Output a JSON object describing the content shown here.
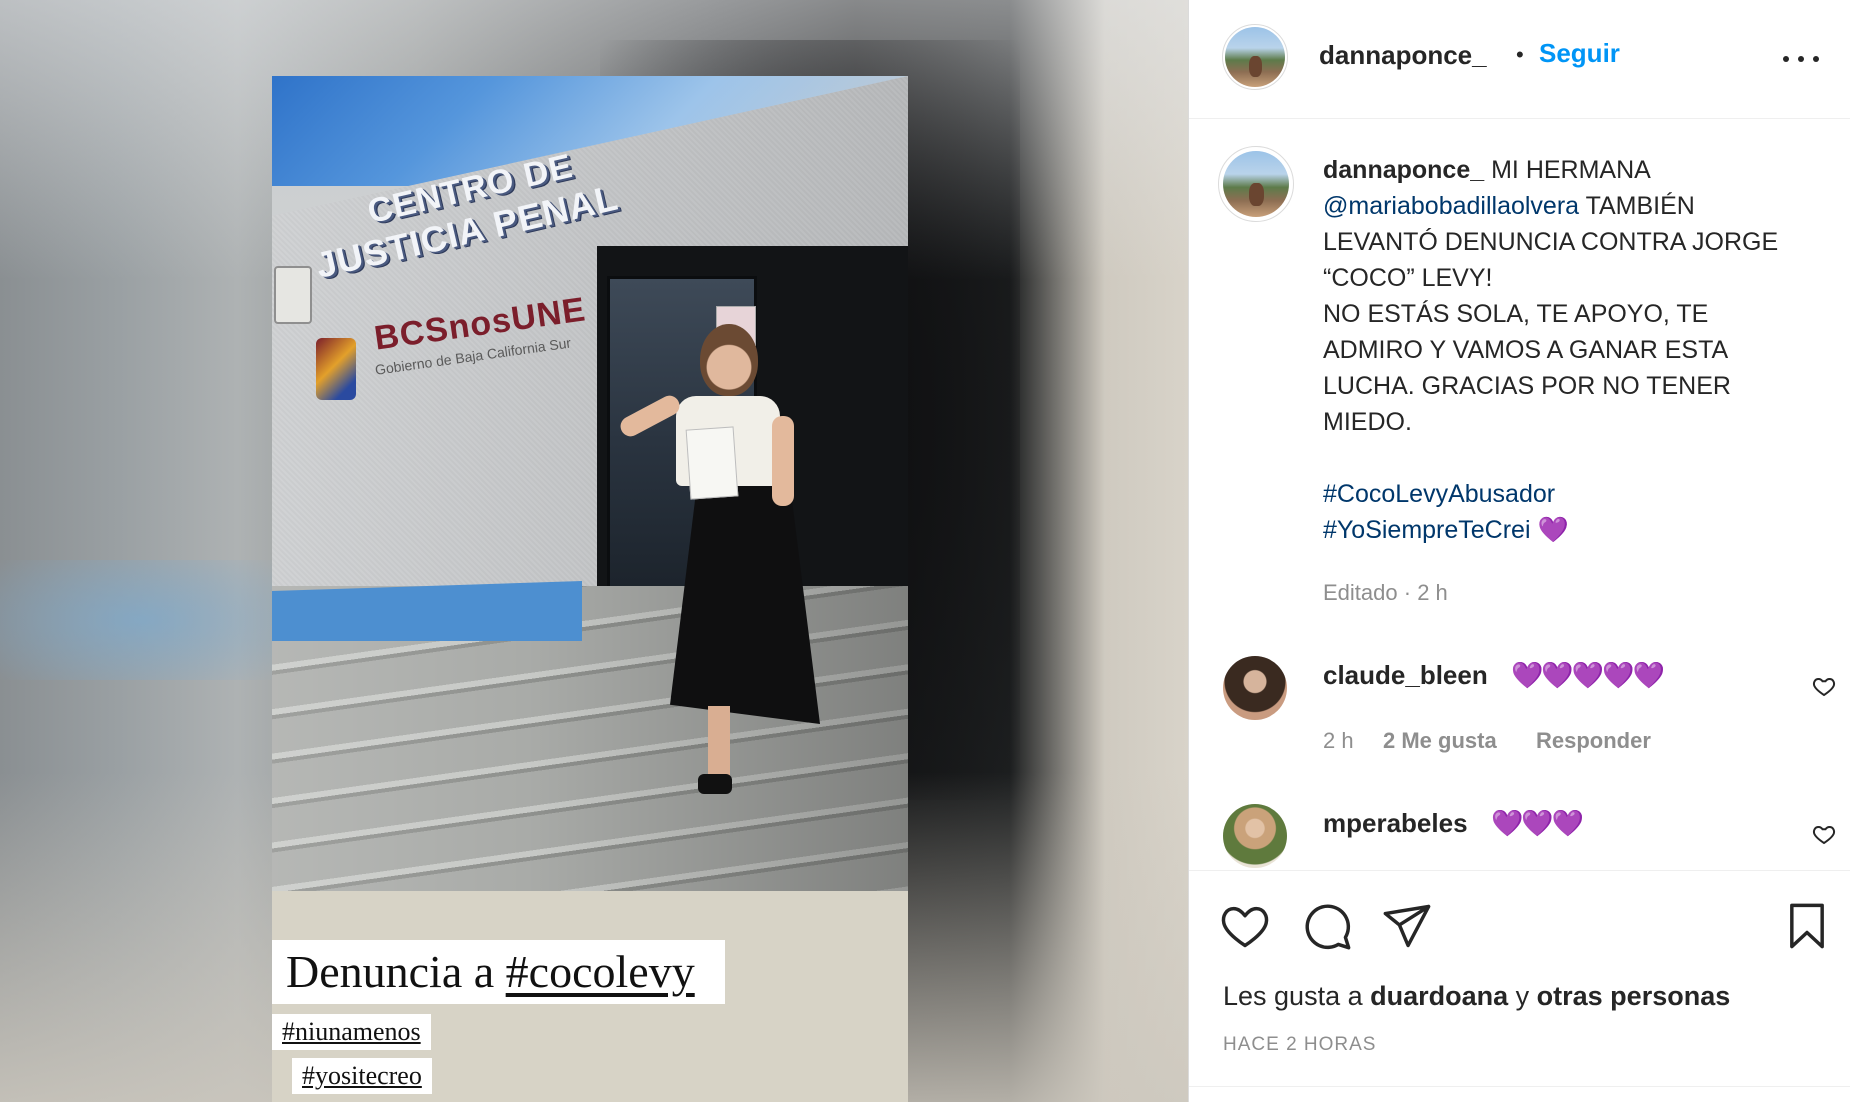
{
  "post": {
    "story_caption_main_prefix": "Denuncia a",
    "story_caption_main_tag": "#cocolevy",
    "story_tag_1": "#niunamenos",
    "story_tag_2": "#yositecreo",
    "building_sign_line_1": "CENTRO DE",
    "building_sign_line_2": "JUSTICIA PENAL",
    "building_logo_text": "BCSnosUNE",
    "building_logo_subtext": "Gobierno de Baja California Sur"
  },
  "header": {
    "username": "dannaponce_",
    "separator": "•",
    "follow_label": "Seguir",
    "more_icon": "more-horizontal-icon"
  },
  "caption": {
    "username": "dannaponce_",
    "text_1": " MI HERMANA ",
    "mention": "@mariabobadillaolvera",
    "text_2": " TAMBIÉN LEVANTÓ DENUNCIA CONTRA JORGE “COCO” LEVY!",
    "text_3": "NO ESTÁS SOLA, TE APOYO, TE ADMIRO Y VAMOS A GANAR ESTA LUCHA. GRACIAS POR NO TENER MIEDO.",
    "hashtag_1": "#CocoLevyAbusador",
    "hashtag_2": "#YoSiempreTeCrei",
    "emoji": "💜",
    "edited_label": "Editado",
    "edited_separator": "·",
    "edited_time": "2 h"
  },
  "comments": [
    {
      "username": "claude_bleen",
      "text": "💜💜💜💜💜",
      "time": "2 h",
      "likes": "2 Me gusta",
      "reply_label": "Responder"
    },
    {
      "username": "mperabeles",
      "text": "💜💜💜"
    }
  ],
  "actions": {
    "like_icon": "heart-icon",
    "comment_icon": "comment-icon",
    "share_icon": "send-icon",
    "save_icon": "bookmark-icon"
  },
  "likes": {
    "prefix": "Les gusta a ",
    "user": "duardoana",
    "middle": " y ",
    "others": "otras personas"
  },
  "timestamp": "HACE 2 HORAS",
  "colors": {
    "link_blue": "#0095f6",
    "mention_navy": "#00376b",
    "muted_gray": "#8e8e8e",
    "text_dark": "#262626"
  }
}
